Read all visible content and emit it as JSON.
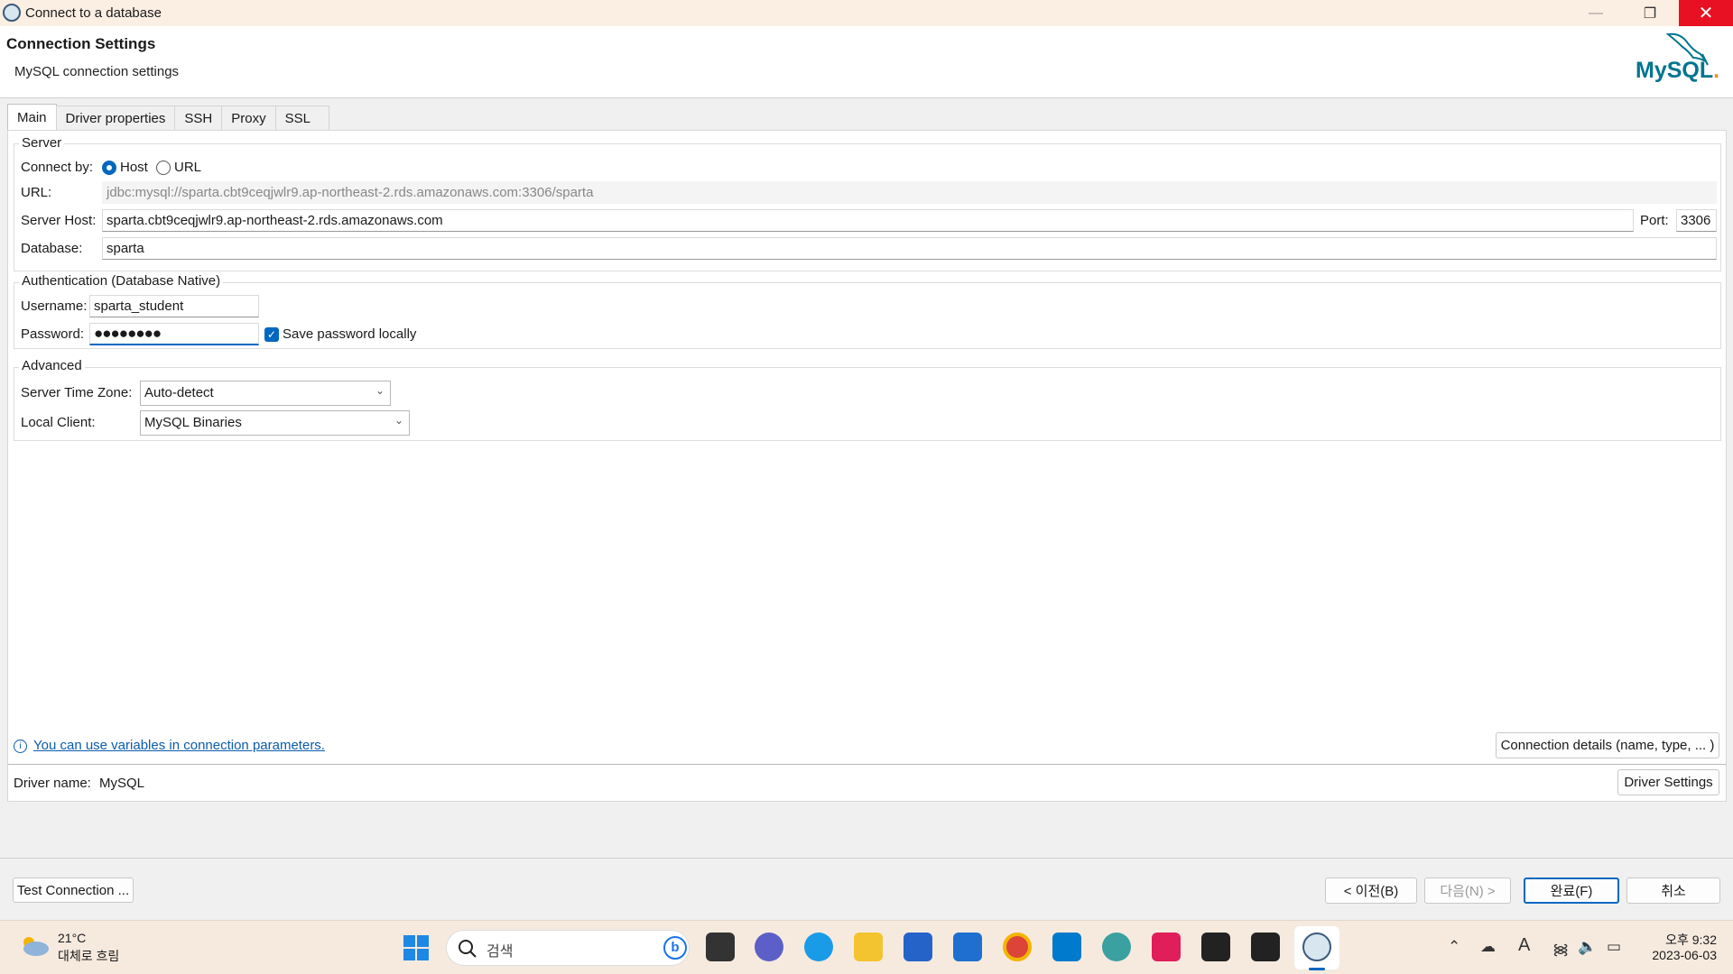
{
  "window": {
    "title": "Connect to a database",
    "minimize": "—",
    "maximize": "❐",
    "close": "✕"
  },
  "header": {
    "title": "Connection Settings",
    "subtitle": "MySQL connection settings",
    "logo_text": "MySQL",
    "logo_dot": "."
  },
  "tabs": [
    {
      "label": "Main",
      "active": true
    },
    {
      "label": "Driver properties"
    },
    {
      "label": "SSH"
    },
    {
      "label": "Proxy"
    },
    {
      "label": "SSL"
    }
  ],
  "server": {
    "group_label": "Server",
    "connect_by_label": "Connect by:",
    "host_option": "Host",
    "url_option": "URL",
    "selected": "Host",
    "url_label": "URL:",
    "url_value": "jdbc:mysql://sparta.cbt9ceqjwlr9.ap-northeast-2.rds.amazonaws.com:3306/sparta",
    "host_label": "Server Host:",
    "host_value": "sparta.cbt9ceqjwlr9.ap-northeast-2.rds.amazonaws.com",
    "port_label": "Port:",
    "port_value": "3306",
    "database_label": "Database:",
    "database_value": "sparta"
  },
  "auth": {
    "group_label": "Authentication (Database Native)",
    "username_label": "Username:",
    "username_value": "sparta_student",
    "password_label": "Password:",
    "password_value": "●●●●●●●●",
    "save_password_label": "Save password locally",
    "save_password_checked": true
  },
  "advanced": {
    "group_label": "Advanced",
    "timezone_label": "Server Time Zone:",
    "timezone_value": "Auto-detect",
    "client_label": "Local Client:",
    "client_value": "MySQL Binaries"
  },
  "footer": {
    "variables_link": "You can use variables in connection parameters.",
    "connection_details_button": "Connection details (name, type, ... )",
    "driver_name_label": "Driver name:",
    "driver_name_value": "MySQL",
    "driver_settings_button": "Driver Settings"
  },
  "actions": {
    "test_connection": "Test Connection ...",
    "back": "< 이전(B)",
    "next": "다음(N) >",
    "finish": "완료(F)",
    "cancel": "취소"
  },
  "taskbar": {
    "weather_temp": "21°C",
    "weather_desc": "대체로 흐림",
    "search_placeholder": "검색",
    "time": "오후 9:32",
    "date": "2023-06-03",
    "ime_indicator": "A"
  },
  "colors": {
    "accent": "#0067c0",
    "close_red": "#e81123",
    "link": "#0b5cad",
    "mysql_blue": "#00758f",
    "mysql_orange": "#f29111"
  }
}
